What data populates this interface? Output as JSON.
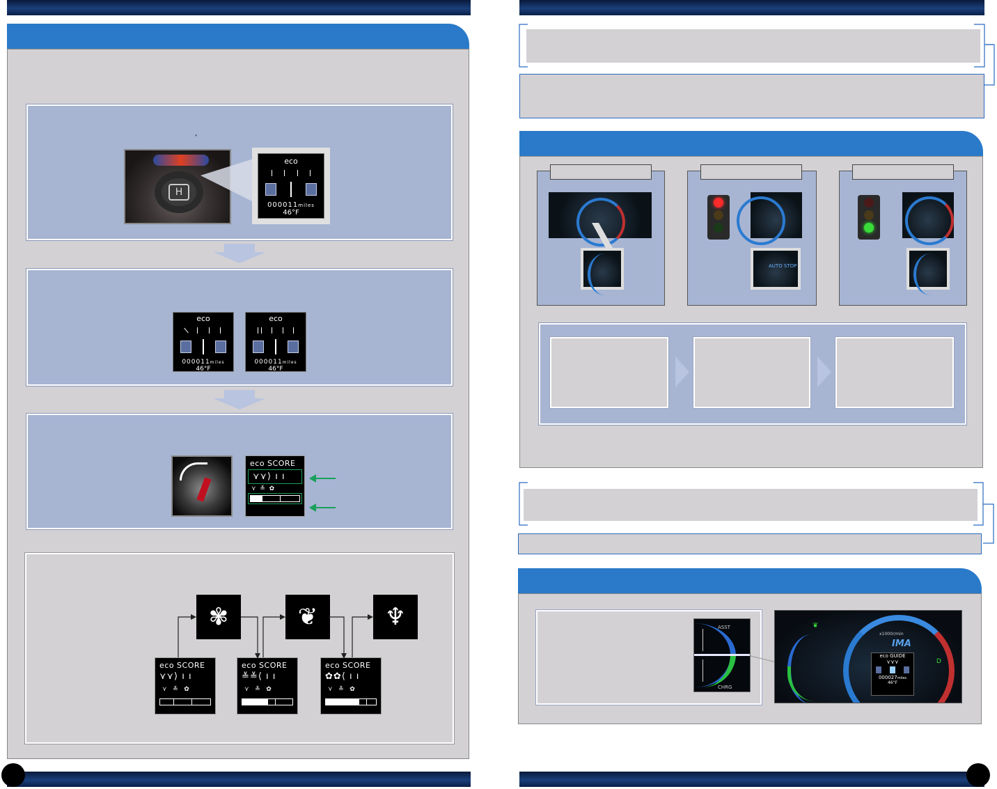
{
  "page": {
    "top_bar_left": "",
    "top_bar_right": "",
    "bottom_bar_left": "",
    "bottom_bar_right": ""
  },
  "left_section": {
    "tab_title": "",
    "intro_text": "",
    "step1": {
      "text": "´",
      "lcd": {
        "title": "eco",
        "odometer": "000011",
        "unit": "miles",
        "temp": "46°F"
      }
    },
    "step2": {
      "text": "",
      "lcd_a": {
        "title": "eco",
        "odometer": "000011",
        "unit": "miles",
        "temp": "46°F"
      },
      "lcd_b": {
        "title": "eco",
        "odometer": "000011",
        "unit": "miles",
        "temp": "46°F"
      }
    },
    "step3": {
      "text": "",
      "score": {
        "title": "eco SCORE"
      }
    },
    "stages": {
      "text": "",
      "scores": [
        {
          "title": "eco SCORE"
        },
        {
          "title": "eco SCORE"
        },
        {
          "title": "eco SCORE"
        }
      ]
    }
  },
  "right_section": {
    "note1": "",
    "note2": "",
    "auto_stop": {
      "tab_title": "",
      "panels": [
        {
          "label": "",
          "zoom_text": ""
        },
        {
          "label": "",
          "zoom_text": "AUTO STOP"
        },
        {
          "label": "",
          "zoom_text": ""
        }
      ],
      "flow_boxes": [
        "",
        "",
        ""
      ],
      "footnote": ""
    },
    "note3": "",
    "note4": "",
    "assist": {
      "tab_title": "",
      "text": "",
      "gauge_labels": {
        "top": "ASST",
        "bottom": "CHRG"
      },
      "cluster": {
        "rpm_label": "x1000r/min",
        "brand": "IMA",
        "guide_title": "eco GUIDE",
        "odometer": "000027",
        "unit": "miles",
        "temp": "46°F",
        "gear": "D"
      }
    }
  },
  "colors": {
    "bar_dark": "#0a1a3a",
    "tab_blue": "#2a7ac9",
    "panel_blue": "#a7b5d3",
    "gray": "#d3d1d4",
    "green_arrow": "#1aa05a"
  }
}
